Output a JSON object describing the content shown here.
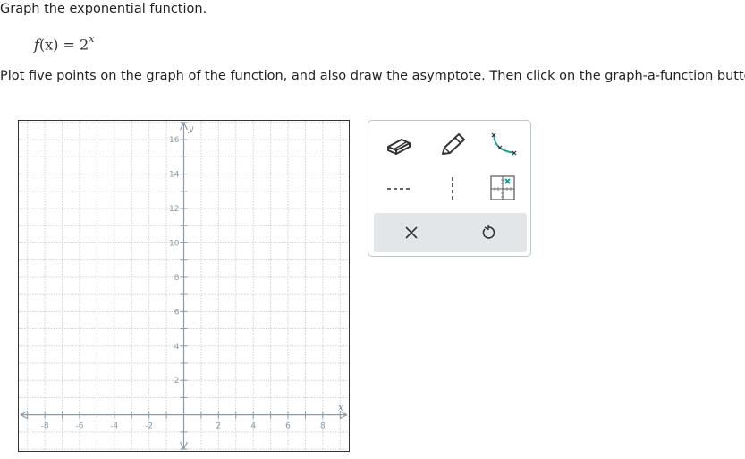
{
  "question": {
    "title": "Graph the exponential function.",
    "function_name": "f",
    "function_arg": "(x) = 2",
    "function_exponent": "x",
    "instruction": "Plot five points on the graph of the function, and also draw the asymptote. Then click on the graph-a-function button."
  },
  "graph": {
    "x_label": "x",
    "y_label": "y",
    "x_min": -9.5,
    "x_max": 9.5,
    "y_min": -2.1,
    "y_max": 17.1,
    "x_ticks": [
      -8,
      -6,
      -4,
      -2,
      2,
      4,
      6,
      8
    ],
    "y_ticks": [
      2,
      4,
      6,
      8,
      10,
      12,
      14,
      16
    ],
    "grid_step": 1,
    "grid": true,
    "axis_color": "#8a9aa6",
    "grid_color": "#c8d0d6"
  },
  "toolbox": {
    "tools": [
      {
        "name": "eraser-tool",
        "icon": "eraser-icon"
      },
      {
        "name": "pencil-tool",
        "icon": "pencil-icon"
      },
      {
        "name": "graph-function-tool",
        "icon": "exponential-curve-icon"
      },
      {
        "name": "dashed-horizontal-line-tool",
        "icon": "dashed-horizontal-line-icon"
      },
      {
        "name": "dashed-vertical-line-tool",
        "icon": "dashed-vertical-line-icon"
      },
      {
        "name": "point-grid-tool",
        "icon": "point-on-grid-icon"
      }
    ],
    "clear_icon": "close-icon",
    "undo_icon": "undo-icon",
    "accent_color": "#1a9e98"
  }
}
